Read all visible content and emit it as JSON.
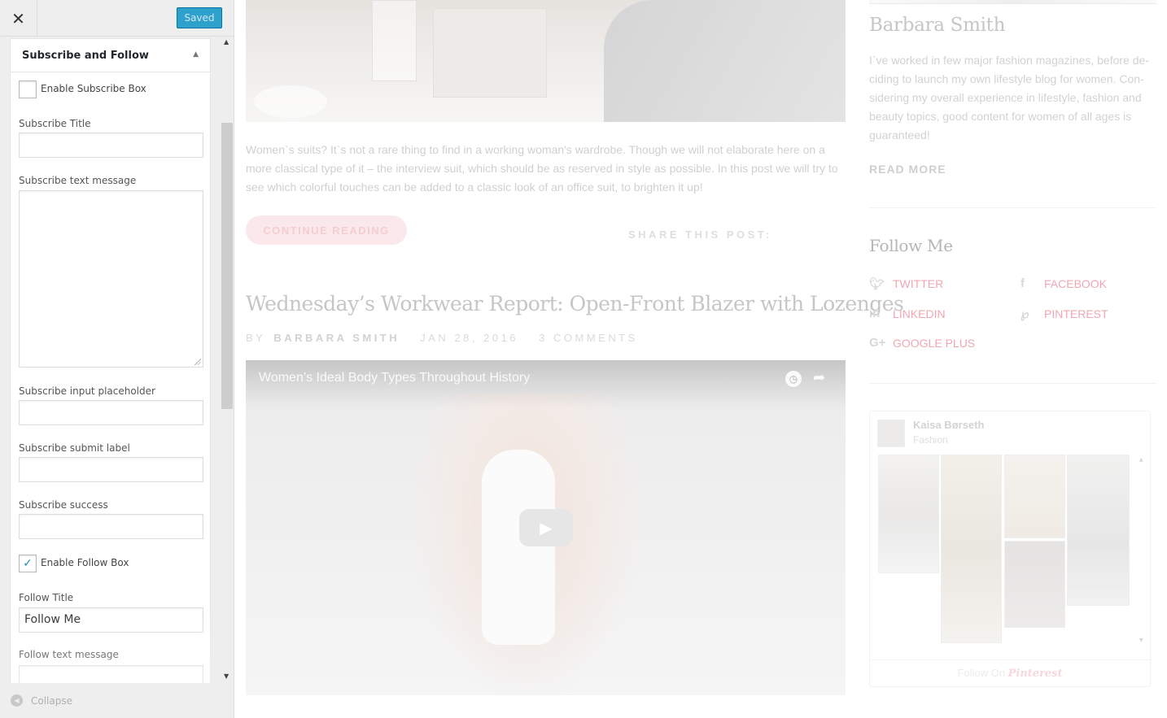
{
  "customizer": {
    "saved_label": "Saved",
    "section_title": "Subscribe and Follow",
    "collapse_label": "Collapse",
    "fields": {
      "enable_subscribe_label": "Enable Subscribe Box",
      "enable_subscribe_checked": false,
      "subscribe_title_label": "Subscribe Title",
      "subscribe_title_value": "",
      "subscribe_text_label": "Subscribe text message",
      "subscribe_placeholder_label": "Subscribe input placeholder",
      "subscribe_placeholder_value": "",
      "subscribe_submit_label": "Subscribe submit label",
      "subscribe_submit_value": "",
      "subscribe_success_label": "Subscribe success",
      "subscribe_success_value": "",
      "enable_follow_label": "Enable Follow Box",
      "enable_follow_checked": true,
      "follow_title_label": "Follow Title",
      "follow_title_value": "Follow Me",
      "follow_text_label": "Follow text message"
    }
  },
  "preview": {
    "excerpt": "Women`s suits? It`s not a rare thing to find in a working woman's wardrobe. Though we will not elaborate here on a more classical type of it – the interview suit, which should be as reserved in style as possible. In this post we will try to see which colorful touches can be added to a classic look of an office suit, to brighten it up!",
    "continue_label": "CONTINUE READING",
    "share_label": "SHARE THIS POST:",
    "post_title": "Wednesday’s Workwear Report: Open-Front Blazer with Lozenges",
    "meta_by": "BY",
    "meta_author": "BARBARA SMITH",
    "meta_date": "JAN 28, 2016",
    "meta_comments": "3 COMMENTS",
    "video_title": "Women’s Ideal Body Types Throughout History"
  },
  "sidebar": {
    "about_name": "Barbara Smith",
    "about_text": "I`ve worked in few major fashion magazines, before de-ciding to launch my own lifestyle blog for women. Con-sidering my overall experience in lifestyle, fashion and beauty topics, good content for women of all ages is guaranteed!",
    "read_more": "READ MORE",
    "follow_title": "Follow Me",
    "social": {
      "twitter": "TWITTER",
      "facebook": "FACEBOOK",
      "linkedin": "LINKEDIN",
      "pinterest": "PINTEREST",
      "googleplus": "GOOGLE PLUS"
    },
    "pinterest_widget": {
      "name": "Kaisa Børseth",
      "category": "Fashion",
      "footer_prefix": "Follow On",
      "footer_brand": "Pinterest"
    }
  },
  "colors": {
    "accent": "#2ea2cc",
    "social_link": "#f1a7b1"
  }
}
